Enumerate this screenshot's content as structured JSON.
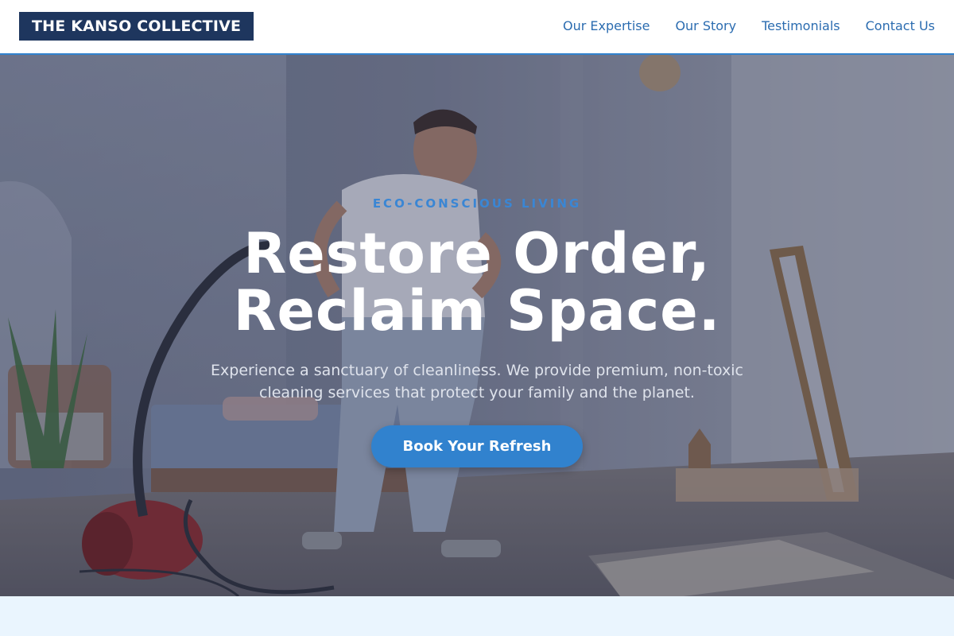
{
  "header": {
    "logo": "THE KANSO COLLECTIVE",
    "nav": [
      {
        "label": "Our Expertise"
      },
      {
        "label": "Our Story"
      },
      {
        "label": "Testimonials"
      },
      {
        "label": "Contact Us"
      }
    ]
  },
  "hero": {
    "eyebrow": "ECO-CONSCIOUS LIVING",
    "title_line1": "Restore Order,",
    "title_line2": "Reclaim Space.",
    "subtitle": "Experience a sanctuary of cleanliness. We provide premium, non-toxic cleaning services that protect your family and the planet.",
    "cta_label": "Book Your Refresh"
  },
  "colors": {
    "logo_bg": "#1e365e",
    "nav_link": "#2b6cb0",
    "accent": "#3182ce",
    "page_bg": "#eaf5fe"
  }
}
